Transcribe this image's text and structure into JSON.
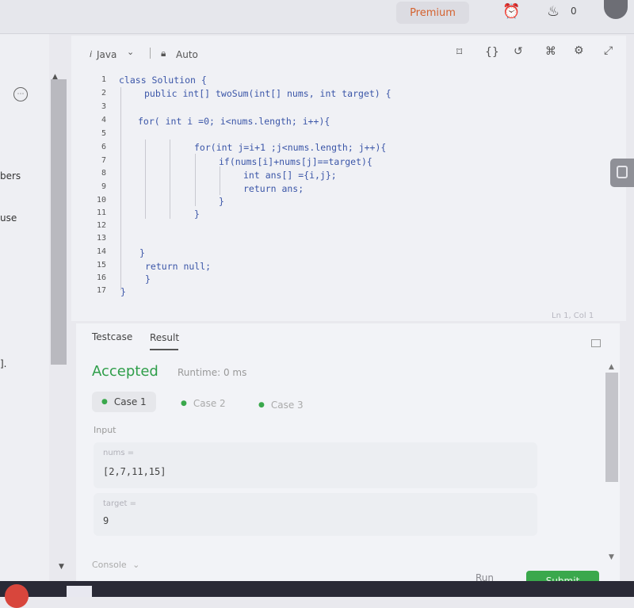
{
  "topbar": {
    "premium_label": "Premium",
    "streak_count": "0",
    "icons": [
      "alarm-clock-icon",
      "flame-icon",
      "user-avatar-icon"
    ]
  },
  "sidebar_fragments": [
    "bers",
    "use",
    "]."
  ],
  "editor": {
    "language": "Java",
    "mode": "Auto",
    "line_numbers": [
      "1",
      "2",
      "3",
      "4",
      "5",
      "6",
      "7",
      "8",
      "9",
      "10",
      "11",
      "12",
      "13",
      "14",
      "15",
      "16",
      "17"
    ],
    "code_lines": [
      "class Solution {",
      "public int[] twoSum(int[] nums, int target) {",
      "",
      "for( int i =0; i<nums.length; i++){",
      "",
      "for(int j=i+1 ;j<nums.length; j++){",
      "if(nums[i]+nums[j]==target){",
      "int ans[] ={i,j};",
      "return ans;",
      "}",
      "}",
      "",
      "",
      "}",
      "return null;",
      "}",
      "}"
    ],
    "status": "Ln 1, Col 1"
  },
  "result": {
    "tabs": [
      "Testcase",
      "Result"
    ],
    "verdict": "Accepted",
    "runtime": "Runtime: 0 ms",
    "cases": [
      "Case 1",
      "Case 2",
      "Case 3"
    ],
    "input_label": "Input",
    "params": [
      {
        "name": "nums =",
        "value": "[2,7,11,15]"
      },
      {
        "name": "target =",
        "value": "9"
      }
    ],
    "console_label": "Console",
    "run_label": "Run",
    "submit_label": "Submit"
  },
  "colors": {
    "accepted": "#2f9e4a",
    "submit": "#3aa84c",
    "premium": "#d4622f",
    "code": "#3b56a8"
  }
}
